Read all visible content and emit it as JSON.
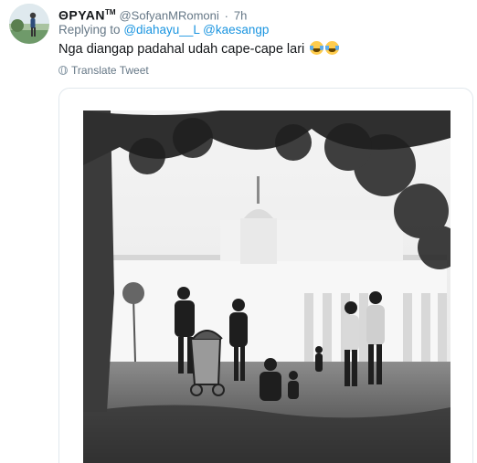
{
  "tweet": {
    "display_name": "ΘPYAN",
    "display_name_mark": "TM",
    "handle": "@SofyanMRomoni",
    "separator": "·",
    "time": "7h",
    "replying_prefix": "Replying to",
    "reply_mentions": [
      "@diahayu__L",
      "@kaesangp"
    ],
    "text": "Nga diangap padahal udah cape-cape lari",
    "emoji_names": [
      "tears-of-joy-emoji",
      "tears-of-joy-emoji"
    ],
    "translate_label": "Translate Tweet",
    "icon": "globe-icon"
  },
  "colors": {
    "link": "#1b95e0",
    "secondary_text": "#657786",
    "primary_text": "#14171a",
    "card_border": "#e1e8ed"
  }
}
